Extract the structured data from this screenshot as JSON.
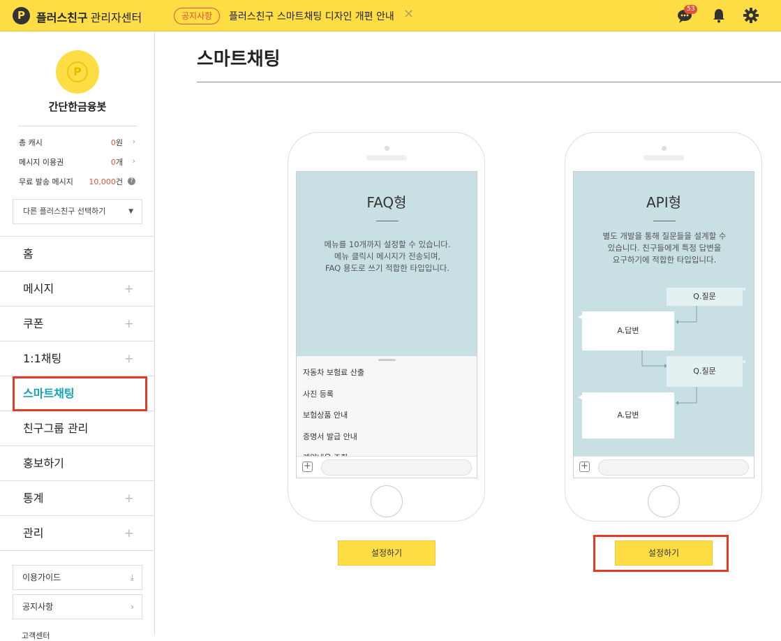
{
  "header": {
    "logo_char": "P",
    "brand": "플러스친구",
    "brand_sub": "관리자센터",
    "notice_badge": "공지사항",
    "notice_text": "플러스친구 스마트채팅 디자인 개편 안내",
    "notice_close": "✕",
    "chat_count": "53",
    "icons": [
      "chat-icon",
      "bell-icon",
      "gear-icon"
    ],
    "accent": "#fedd45"
  },
  "sidebar": {
    "profile_logo_char": "P",
    "profile_name": "간단한금융봇",
    "stats": [
      {
        "label": "총 캐시",
        "value": "0",
        "unit": "원",
        "trail": "›"
      },
      {
        "label": "메시지 이용권",
        "value": "0",
        "unit": "개",
        "trail": "›"
      },
      {
        "label": "무료 발송 메시지",
        "value": "10,000",
        "unit": "건",
        "trail": "?"
      }
    ],
    "select_label": "다른 플러스친구 선택하기",
    "menu": [
      {
        "label": "홈",
        "plus": ""
      },
      {
        "label": "메시지",
        "plus": "+"
      },
      {
        "label": "쿠폰",
        "plus": "+"
      },
      {
        "label": "1:1채팅",
        "plus": "+"
      },
      {
        "label": "스마트채팅",
        "plus": ""
      },
      {
        "label": "친구그룹 관리",
        "plus": ""
      },
      {
        "label": "홍보하기",
        "plus": ""
      },
      {
        "label": "통계",
        "plus": "+"
      },
      {
        "label": "관리",
        "plus": "+"
      }
    ],
    "guide_label": "이용가이드",
    "notice_label": "공지사항",
    "help_label": "고객센터"
  },
  "main": {
    "title": "스마트채팅",
    "faq": {
      "title": "FAQ형",
      "desc": [
        "메뉴를 10개까지 설정할 수 있습니다.",
        "메뉴 클릭시 메시지가 전송되며,",
        "FAQ 용도로 쓰기 적합한 타입입니다."
      ],
      "items": [
        "자동차 보험료 산출",
        "사진 등록",
        "보험상품 안내",
        "증명서 발급 안내",
        "계약내용 조회"
      ],
      "button": "설정하기"
    },
    "api": {
      "title": "API형",
      "desc": [
        "별도 개발을 통해 질문들을 설계할 수",
        "있습니다. 친구들에게 특정 답변을",
        "요구하기에 적합한 타입입니다."
      ],
      "question_label": "Q.질문",
      "answer_label": "A.답변",
      "button": "설정하기"
    }
  }
}
